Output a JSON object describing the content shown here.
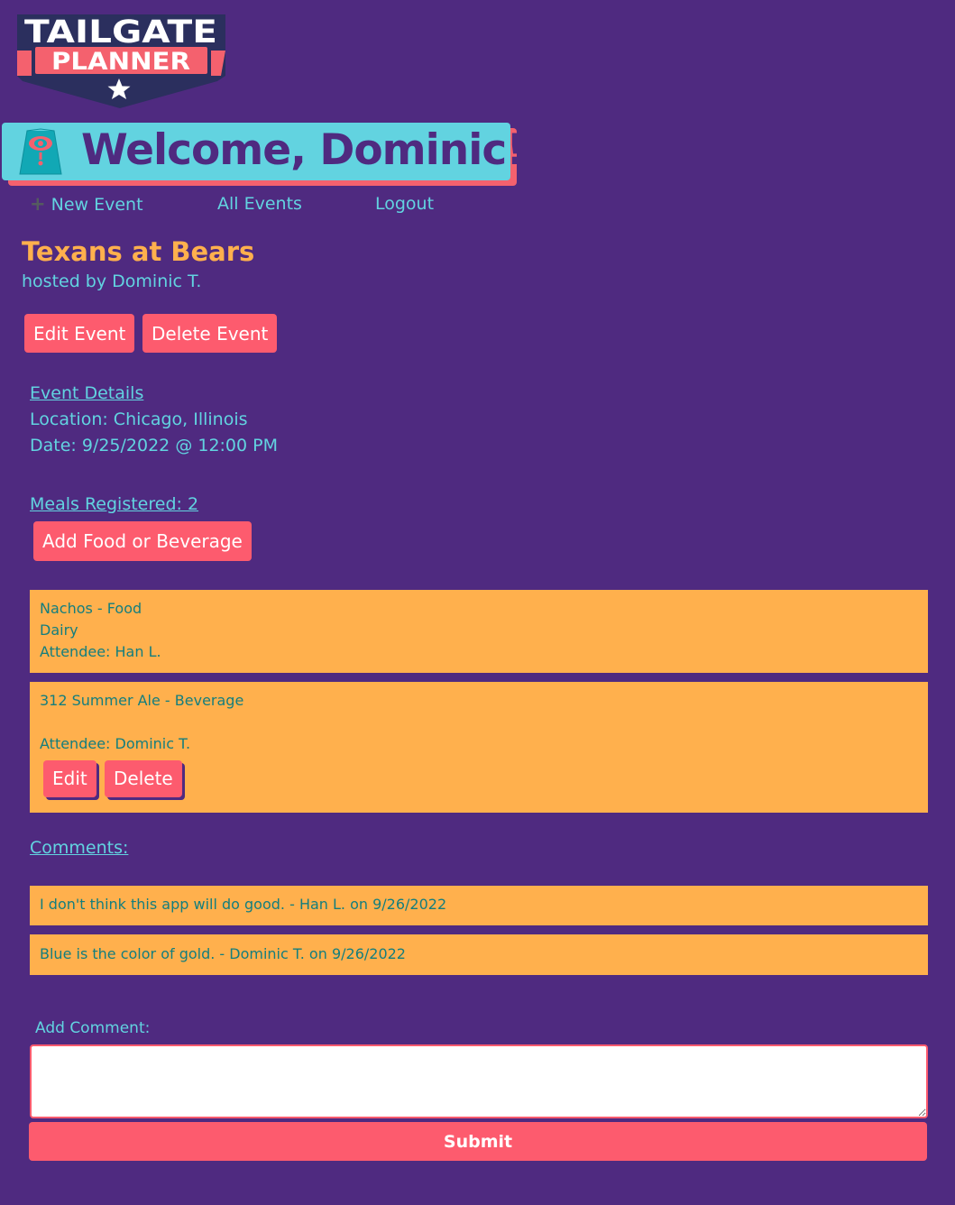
{
  "logo": {
    "line1": "TAILGATE",
    "line2": "PLANNER"
  },
  "welcome": {
    "text": "Welcome, Dominic!"
  },
  "nav": {
    "new_event": "New Event",
    "all_events": "All Events",
    "logout": "Logout"
  },
  "event": {
    "title": "Texans at Bears",
    "host": "hosted by Dominic T.",
    "edit_label": "Edit Event",
    "delete_label": "Delete Event"
  },
  "details": {
    "heading": "Event Details",
    "location": "Location: Chicago, Illinois",
    "date": "Date: 9/25/2022 @ 12:00 PM"
  },
  "meals": {
    "heading": "Meals Registered: 2",
    "add_label": "Add Food or Beverage",
    "items": [
      {
        "title": "Nachos - Food",
        "note": "Dairy",
        "attendee": "Attendee: Han L."
      },
      {
        "title": "312 Summer Ale - Beverage",
        "note": "",
        "attendee": "Attendee: Dominic T.",
        "edit_label": "Edit",
        "delete_label": "Delete"
      }
    ]
  },
  "comments": {
    "heading": "Comments:",
    "items": [
      "I don't think this app will do good. - Han L. on 9/26/2022",
      "Blue is the color of gold. - Dominic T. on 9/26/2022"
    ],
    "add_label": "Add Comment:",
    "input_value": "",
    "submit_label": "Submit"
  },
  "colors": {
    "background": "#4f2a80",
    "accent_cyan": "#62d3e0",
    "accent_orange": "#ffb04d",
    "button_red": "#fd5b6e",
    "card_text": "#137e7e",
    "logo_navy": "#2b2f5e"
  },
  "icons": {
    "banner_icon": "eye-tent-icon",
    "nav_plus": "plus-icon",
    "logo_star": "star-icon"
  }
}
